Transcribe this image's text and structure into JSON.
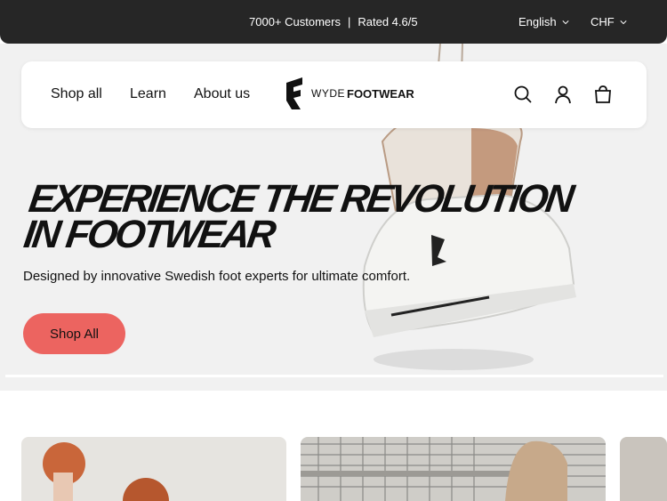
{
  "announcement": {
    "customers": "7000+ Customers",
    "separator": "|",
    "rating": "Rated 4.6/5",
    "language": "English",
    "currency": "CHF"
  },
  "nav": {
    "links": [
      "Shop all",
      "Learn",
      "About us"
    ],
    "logo_prefix": "WYDE",
    "logo_suffix": "FOOTWEAR",
    "icons": [
      "search-icon",
      "account-icon",
      "cart-icon"
    ]
  },
  "hero": {
    "headline": "EXPERIENCE THE REVOLUTION IN FOOTWEAR",
    "subtitle": "Designed by innovative Swedish foot experts for ultimate comfort.",
    "cta_label": "Shop All",
    "cta_color": "#ec6460"
  },
  "colors": {
    "topbar": "#262626",
    "hero_bg": "#f1f1f1"
  }
}
